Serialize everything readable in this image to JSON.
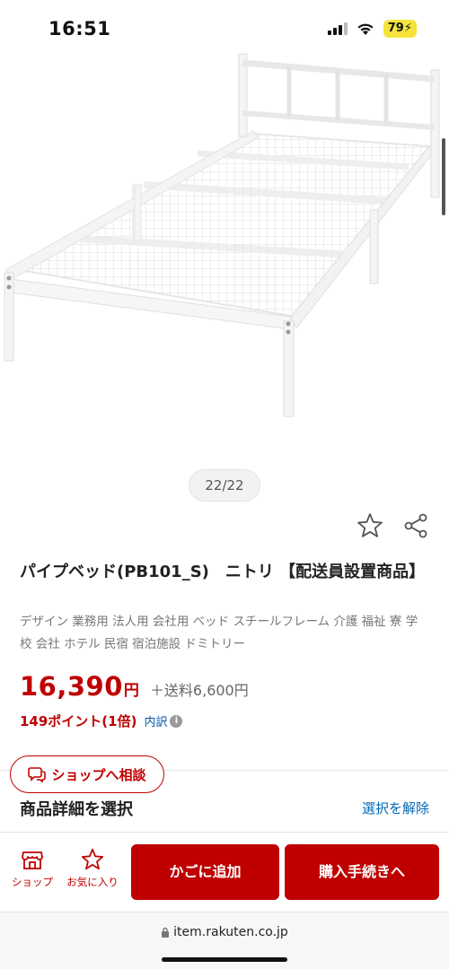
{
  "status_bar": {
    "time": "16:51",
    "battery": "79"
  },
  "gallery": {
    "counter": "22/22"
  },
  "product": {
    "title": "パイプベッド(PB101_S)　ニトリ 【配送員設置商品】",
    "tags": "デザイン 業務用 法人用 会社用 ベッド スチールフレーム 介護 福祉 寮 学校 会社 ホテル 民宿 宿泊施設 ドミトリー",
    "price": "16,390",
    "price_unit": "円",
    "shipping": "＋送料6,600円",
    "points": "149ポイント(1倍)",
    "breakdown": "内訳"
  },
  "consult": {
    "label": "ショップへ相談"
  },
  "selection": {
    "heading": "商品詳細を選択",
    "deselect": "選択を解除"
  },
  "actions": {
    "shop_label": "ショップ",
    "fav_label": "お気に入り",
    "cart_label": "かごに追加",
    "buy_label": "購入手続きへ"
  },
  "browser": {
    "url": "item.rakuten.co.jp"
  },
  "colors": {
    "accent": "#bf0000",
    "link": "#0068b7"
  }
}
